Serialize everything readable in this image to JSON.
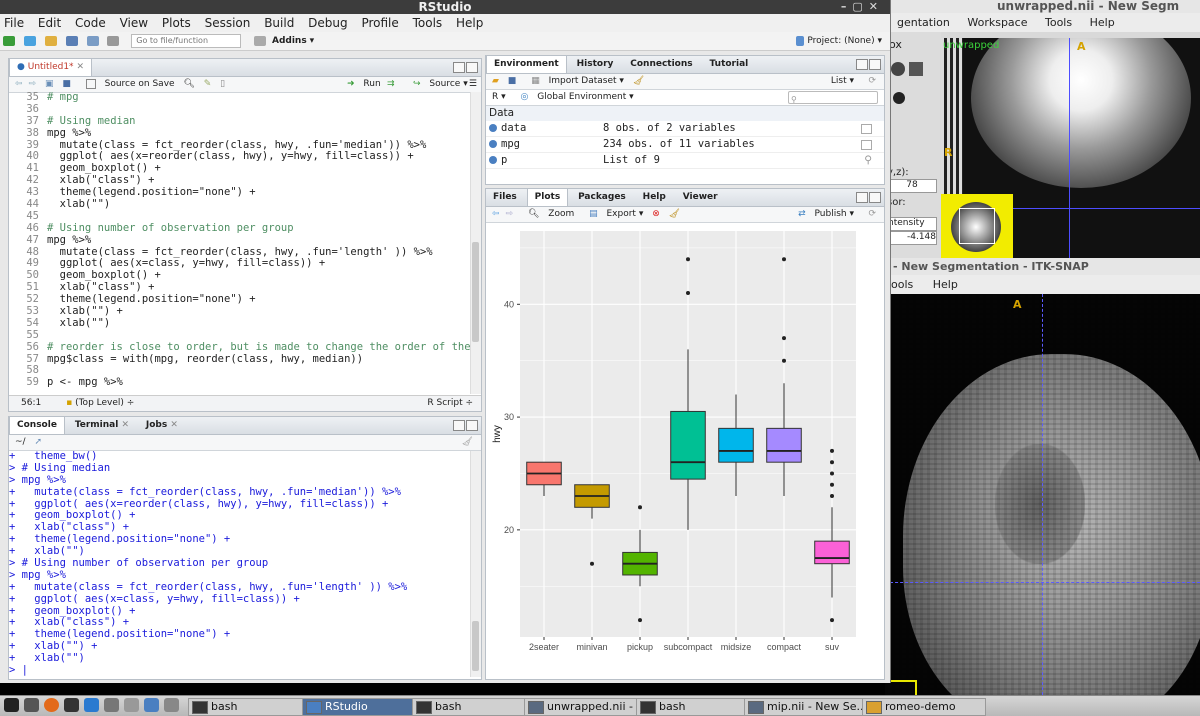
{
  "itk_back": {
    "title": "unwrapped.nii - New Segm",
    "menu": [
      "gentation",
      "Workspace",
      "Tools",
      "Help"
    ],
    "side_labels": [
      "ox",
      "y,z):",
      "78",
      "sor:",
      "ntensity",
      "-4.148"
    ],
    "view_labels": [
      "unwrapped",
      "A",
      "R"
    ]
  },
  "itk_front": {
    "title": "- New Segmentation - ITK-SNAP",
    "menu": [
      "ools",
      "Help"
    ],
    "view_label": "A"
  },
  "rstudio": {
    "title": "RStudio",
    "menu": [
      "File",
      "Edit",
      "Code",
      "View",
      "Plots",
      "Session",
      "Build",
      "Debug",
      "Profile",
      "Tools",
      "Help"
    ],
    "toolbar": {
      "goto_placeholder": "Go to file/function",
      "addins": "Addins",
      "project": "Project: (None)"
    }
  },
  "editor": {
    "tab": "Untitled1*",
    "source_on_save": "Source on Save",
    "run": "Run",
    "source": "Source",
    "status_pos": "56:1",
    "status_scope": "(Top Level)",
    "status_type": "R Script",
    "lines": [
      {
        "n": "35",
        "t": "# mpg",
        "k": "cm"
      },
      {
        "n": "36",
        "t": "",
        "k": ""
      },
      {
        "n": "37",
        "t": "# Using median",
        "k": "cm"
      },
      {
        "n": "38",
        "t": "mpg %>%",
        "k": ""
      },
      {
        "n": "39",
        "t": "  mutate(class = fct_reorder(class, hwy, .fun='median')) %>%",
        "k": ""
      },
      {
        "n": "40",
        "t": "  ggplot( aes(x=reorder(class, hwy), y=hwy, fill=class)) +",
        "k": ""
      },
      {
        "n": "41",
        "t": "  geom_boxplot() +",
        "k": ""
      },
      {
        "n": "42",
        "t": "  xlab(\"class\") +",
        "k": ""
      },
      {
        "n": "43",
        "t": "  theme(legend.position=\"none\") +",
        "k": ""
      },
      {
        "n": "44",
        "t": "  xlab(\"\")",
        "k": ""
      },
      {
        "n": "45",
        "t": "",
        "k": ""
      },
      {
        "n": "46",
        "t": "# Using number of observation per group",
        "k": "cm"
      },
      {
        "n": "47",
        "t": "mpg %>%",
        "k": ""
      },
      {
        "n": "48",
        "t": "  mutate(class = fct_reorder(class, hwy, .fun='length' )) %>%",
        "k": ""
      },
      {
        "n": "49",
        "t": "  ggplot( aes(x=class, y=hwy, fill=class)) +",
        "k": ""
      },
      {
        "n": "50",
        "t": "  geom_boxplot() +",
        "k": ""
      },
      {
        "n": "51",
        "t": "  xlab(\"class\") +",
        "k": ""
      },
      {
        "n": "52",
        "t": "  theme(legend.position=\"none\") +",
        "k": ""
      },
      {
        "n": "53",
        "t": "  xlab(\"\") +",
        "k": ""
      },
      {
        "n": "54",
        "t": "  xlab(\"\")",
        "k": ""
      },
      {
        "n": "55",
        "t": "",
        "k": ""
      },
      {
        "n": "56",
        "t": "# reorder is close to order, but is made to change the order of the fac",
        "k": "cm"
      },
      {
        "n": "57",
        "t": "mpg$class = with(mpg, reorder(class, hwy, median))",
        "k": ""
      },
      {
        "n": "58",
        "t": "",
        "k": ""
      },
      {
        "n": "59",
        "t": "p <- mpg %>%",
        "k": ""
      }
    ]
  },
  "console": {
    "tabs": [
      "Console",
      "Terminal",
      "Jobs"
    ],
    "path": "~/",
    "lines": [
      "+   theme_bw()",
      "> # Using median",
      "> mpg %>%",
      "+   mutate(class = fct_reorder(class, hwy, .fun='median')) %>%",
      "+   ggplot( aes(x=reorder(class, hwy), y=hwy, fill=class)) +",
      "+   geom_boxplot() +",
      "+   xlab(\"class\") +",
      "+   theme(legend.position=\"none\") +",
      "+   xlab(\"\")",
      "> # Using number of observation per group",
      "> mpg %>%",
      "+   mutate(class = fct_reorder(class, hwy, .fun='length' )) %>%",
      "+   ggplot( aes(x=class, y=hwy, fill=class)) +",
      "+   geom_boxplot() +",
      "+   xlab(\"class\") +",
      "+   theme(legend.position=\"none\") +",
      "+   xlab(\"\") +",
      "+   xlab(\"\")",
      "> |"
    ]
  },
  "environment": {
    "tabs": [
      "Environment",
      "History",
      "Connections",
      "Tutorial"
    ],
    "import_dataset": "Import Dataset",
    "list_view": "List",
    "lang": "R",
    "scope": "Global Environment",
    "section": "Data",
    "rows": [
      {
        "name": "data",
        "value": "8 obs. of 2 variables"
      },
      {
        "name": "mpg",
        "value": "234 obs. of 11 variables"
      },
      {
        "name": "p",
        "value": "List of  9"
      }
    ]
  },
  "plots": {
    "tabs": [
      "Files",
      "Plots",
      "Packages",
      "Help",
      "Viewer"
    ],
    "zoom": "Zoom",
    "export": "Export",
    "publish": "Publish"
  },
  "chart_data": {
    "type": "boxplot",
    "xlabel": "",
    "ylabel": "hwy",
    "ylim": [
      10.5,
      46.5
    ],
    "yticks": [
      20,
      30,
      40
    ],
    "grid": true,
    "legend": "none",
    "categories": [
      "2seater",
      "minivan",
      "pickup",
      "subcompact",
      "midsize",
      "compact",
      "suv"
    ],
    "boxes": [
      {
        "class": "2seater",
        "min": 23,
        "q1": 24,
        "median": 25,
        "q3": 26,
        "max": 26,
        "outliers": [],
        "color": "#F8766D"
      },
      {
        "class": "minivan",
        "min": 21,
        "q1": 22,
        "median": 23,
        "q3": 24,
        "max": 24,
        "outliers": [
          17
        ],
        "color": "#C49A00"
      },
      {
        "class": "pickup",
        "min": 15,
        "q1": 16,
        "median": 17,
        "q3": 18,
        "max": 20,
        "outliers": [
          12,
          22
        ],
        "color": "#53B400"
      },
      {
        "class": "subcompact",
        "min": 20,
        "q1": 24.5,
        "median": 26,
        "q3": 30.5,
        "max": 36,
        "outliers": [
          41,
          44
        ],
        "color": "#00C094"
      },
      {
        "class": "midsize",
        "min": 23,
        "q1": 26,
        "median": 27,
        "q3": 29,
        "max": 32,
        "outliers": [],
        "color": "#00B6EB"
      },
      {
        "class": "compact",
        "min": 23,
        "q1": 26,
        "median": 27,
        "q3": 29,
        "max": 33,
        "outliers": [
          35,
          37,
          44
        ],
        "color": "#A58AFF"
      },
      {
        "class": "suv",
        "min": 14,
        "q1": 17,
        "median": 17.5,
        "q3": 19,
        "max": 22,
        "outliers": [
          12,
          23,
          24,
          25,
          26,
          27
        ],
        "color": "#FB61D7"
      }
    ]
  },
  "taskbar": {
    "tasks": [
      "bash",
      "RStudio",
      "bash",
      "unwrapped.nii - ...",
      "bash",
      "mip.nii - New Se...",
      "romeo-demo"
    ]
  }
}
